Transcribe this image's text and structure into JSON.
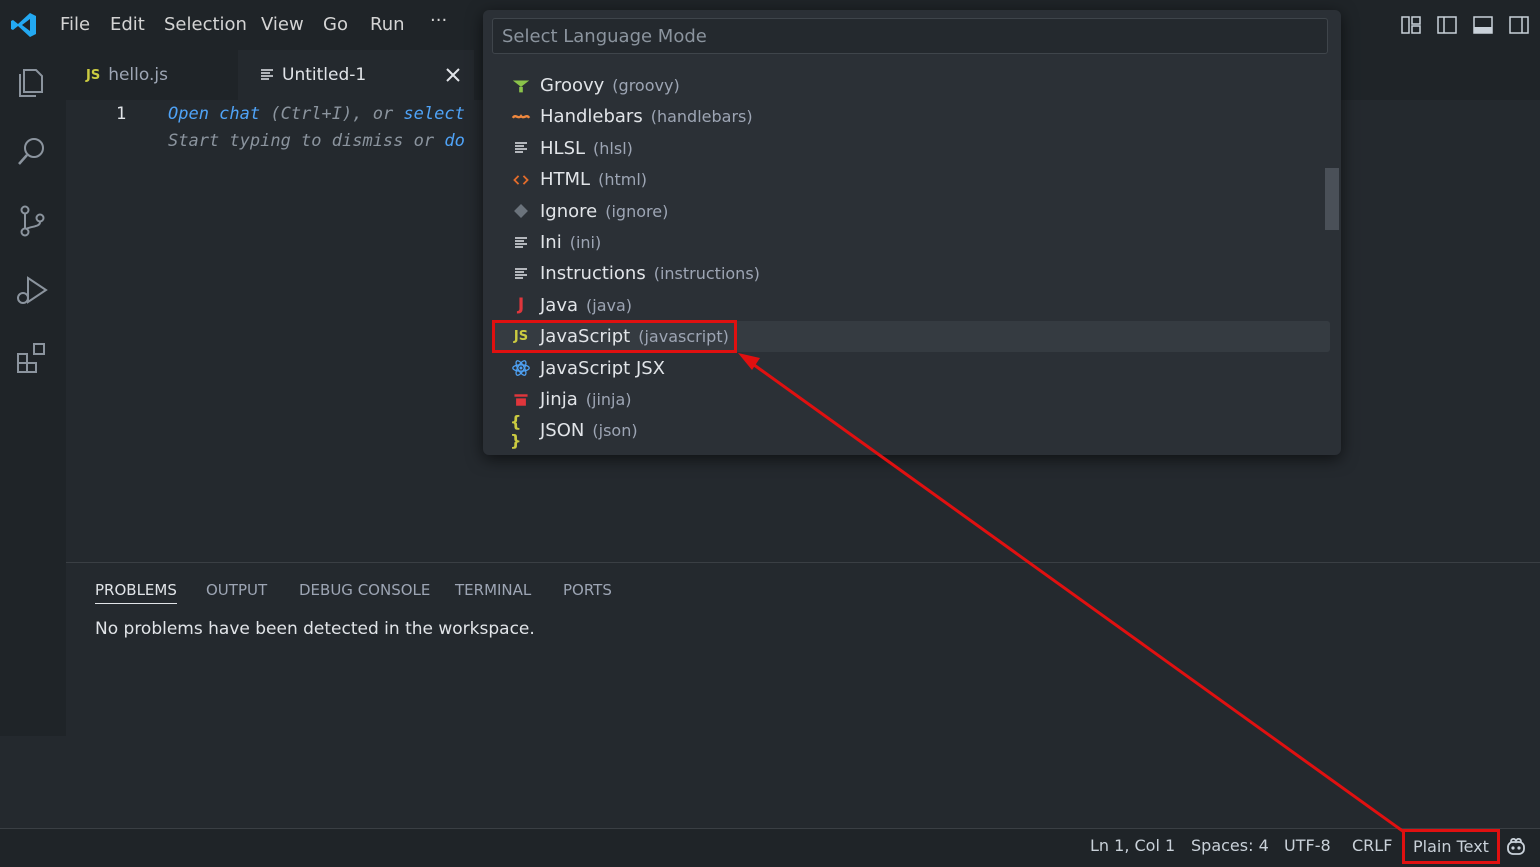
{
  "menu": [
    "File",
    "Edit",
    "Selection",
    "View",
    "Go",
    "Run",
    "···"
  ],
  "tabs": {
    "hello": "hello.js",
    "untitled": "Untitled-1",
    "js_badge": "JS"
  },
  "editor": {
    "line_number": "1",
    "hint1": {
      "a": "Open chat",
      "b": " (Ctrl+I), or ",
      "c": "select"
    },
    "hint2": {
      "a": "Start typing to dismiss or ",
      "b": "do"
    }
  },
  "panel": {
    "tabs": [
      "PROBLEMS",
      "OUTPUT",
      "DEBUG CONSOLE",
      "TERMINAL",
      "PORTS"
    ],
    "message": "No problems have been detected in the workspace."
  },
  "quickpick": {
    "placeholder": "Select Language Mode",
    "items": [
      {
        "label": "Groovy",
        "id": "(groovy)",
        "icon": "groovy-icon",
        "color": "#8bc34a"
      },
      {
        "label": "Handlebars",
        "id": "(handlebars)",
        "icon": "handlebars-icon",
        "color": "#f0883e"
      },
      {
        "label": "HLSL",
        "id": "(hlsl)",
        "icon": "lines-icon",
        "color": "#e1e4e8"
      },
      {
        "label": "HTML",
        "id": "(html)",
        "icon": "html-icon",
        "color": "#e36c2b"
      },
      {
        "label": "Ignore",
        "id": "(ignore)",
        "icon": "git-icon",
        "color": "#6b737c"
      },
      {
        "label": "Ini",
        "id": "(ini)",
        "icon": "lines-icon",
        "color": "#e1e4e8"
      },
      {
        "label": "Instructions",
        "id": "(instructions)",
        "icon": "lines-icon",
        "color": "#e1e4e8"
      },
      {
        "label": "Java",
        "id": "(java)",
        "icon": "java-icon",
        "color": "#e0363c"
      },
      {
        "label": "JavaScript",
        "id": "(javascript)",
        "icon": "js-icon",
        "color": "#cbcb41",
        "selected": true
      },
      {
        "label": "JavaScript JSX",
        "id": "",
        "icon": "react-icon",
        "color": "#4fa3f7"
      },
      {
        "label": "Jinja",
        "id": "(jinja)",
        "icon": "jinja-icon",
        "color": "#e0363c"
      },
      {
        "label": "JSON",
        "id": "(json)",
        "icon": "json-icon",
        "color": "#cbcb41"
      }
    ]
  },
  "status": {
    "position": "Ln 1, Col 1",
    "spaces": "Spaces: 4",
    "encoding": "UTF-8",
    "eol": "CRLF",
    "language": "Plain Text"
  }
}
